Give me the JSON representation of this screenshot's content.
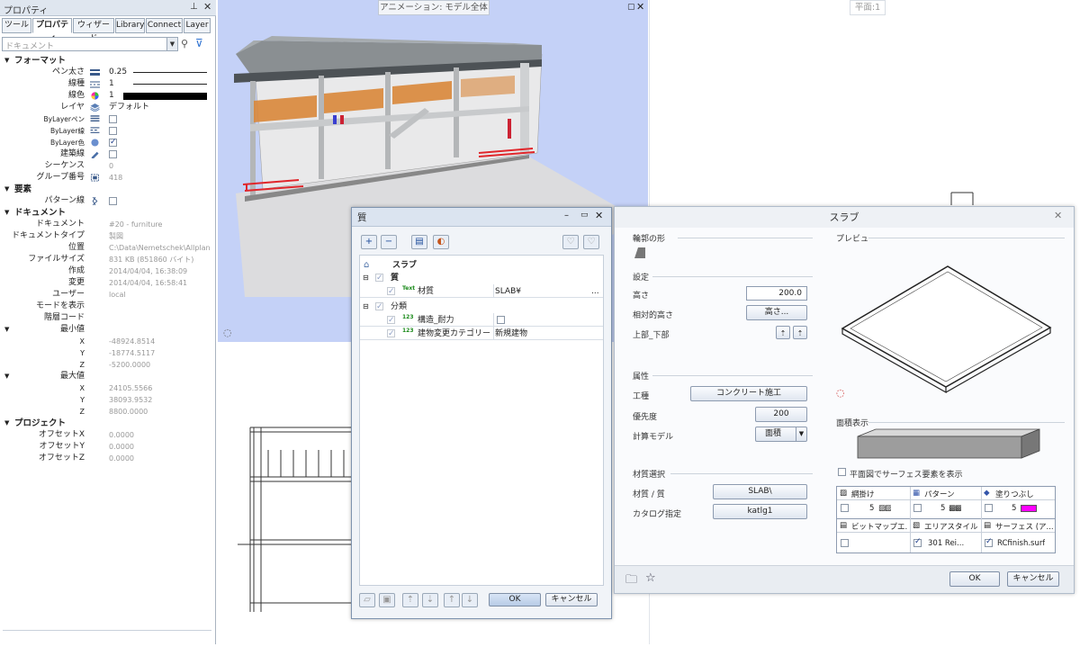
{
  "left_panel": {
    "title": "プロパティ",
    "tabs": [
      "ツール",
      "プロパティ",
      "ウィザード",
      "Library",
      "Connect",
      "Layer"
    ],
    "doc_select_placeholder": "ドキュメント",
    "sections": {
      "format": "フォーマット",
      "element": "要素",
      "document": "ドキュメント",
      "project": "プロジェクト"
    },
    "format_rows": [
      {
        "label": "ペン太さ",
        "value": "0.25"
      },
      {
        "label": "線種",
        "value": "1"
      },
      {
        "label": "線色",
        "value": "1"
      },
      {
        "label": "レイヤ",
        "value": "デフォルト"
      },
      {
        "label": "ByLayerペン",
        "value": ""
      },
      {
        "label": "ByLayer線",
        "value": ""
      },
      {
        "label": "ByLayer色",
        "value": ""
      },
      {
        "label": "建築線",
        "value": ""
      },
      {
        "label": "シーケンス",
        "value": "0"
      },
      {
        "label": "グループ番号",
        "value": "418"
      }
    ],
    "bylayer_color_checked": true,
    "element_rows": [
      {
        "label": "パターン線",
        "value": ""
      }
    ],
    "document_rows": [
      {
        "label": "ドキュメント",
        "value": "#20 - furniture"
      },
      {
        "label": "ドキュメントタイプ",
        "value": "製図"
      },
      {
        "label": "位置",
        "value": "C:\\Data\\Nemetschek\\Allplan\\"
      },
      {
        "label": "ファイルサイズ",
        "value": "831 KB (851860 バイト)"
      },
      {
        "label": "作成",
        "value": "2014/04/04, 16:38:09"
      },
      {
        "label": "変更",
        "value": "2014/04/04, 16:58:41"
      },
      {
        "label": "ユーザー",
        "value": "local"
      },
      {
        "label": "モードを表示",
        "value": ""
      },
      {
        "label": "階層コード",
        "value": ""
      }
    ],
    "min_label": "最小値",
    "min": {
      "X": "-48924.8514",
      "Y": "-18774.5117",
      "Z": "-5200.0000"
    },
    "max_label": "最大値",
    "max": {
      "X": "24105.5566",
      "Y": "38093.9532",
      "Z": "8800.0000"
    },
    "project_rows": [
      {
        "label": "オフセットX",
        "value": "0.0000"
      },
      {
        "label": "オフセットY",
        "value": "0.0000"
      },
      {
        "label": "オフセットZ",
        "value": "0.0000"
      }
    ],
    "pin_icon": "pin-icon",
    "close_icon": "close-icon"
  },
  "viewport": {
    "title": "アニメーション: モデル全体",
    "plan_title": "平面:1"
  },
  "material_dialog": {
    "title": "質",
    "tree": {
      "root": "スラブ",
      "group1": "質",
      "item1_label": "材質",
      "item1_value": "SLAB¥",
      "item1_btn": "...",
      "group2": "分類",
      "item2_label": "構造_耐力",
      "item3_label": "建物変更カテゴリー",
      "item3_value": "新規建物"
    },
    "ok": "OK",
    "cancel": "キャンセル"
  },
  "slab_dialog": {
    "title": "スラブ",
    "outline_label": "輪郭の形",
    "settings_label": "設定",
    "height_label": "高さ",
    "height_value": "200.0",
    "rel_height_label": "相対的高さ",
    "rel_height_btn": "高さ...",
    "top_bottom_label": "上部_下部",
    "attr_label": "属性",
    "trade_label": "工種",
    "trade_value": "コンクリート施工",
    "priority_label": "優先度",
    "priority_value": "200",
    "calc_label": "計算モデル",
    "calc_value": "面積",
    "material_group_label": "材質選択",
    "material_label": "材質 / 質",
    "material_value": "SLAB\\",
    "catalog_label": "カタログ指定",
    "catalog_value": "katlg1",
    "preview_label": "プレビュー",
    "area_display_label": "面積表示",
    "surface_check_label": "平面図でサーフェス要素を表示",
    "table": {
      "h1": "網掛け",
      "h2": "パターン",
      "h3": "塗りつぶし",
      "r1v1": "5",
      "r1v2": "5",
      "r1v3": "5",
      "h4": "ビットマップエ...",
      "h5": "エリアスタイル",
      "h6": "サーフェス (ア...",
      "r2v2": "301 Rei...",
      "r2v3": "RCfinish.surf"
    },
    "fill_color": "#ff00ff",
    "ok": "OK",
    "cancel": "キャンセル"
  }
}
